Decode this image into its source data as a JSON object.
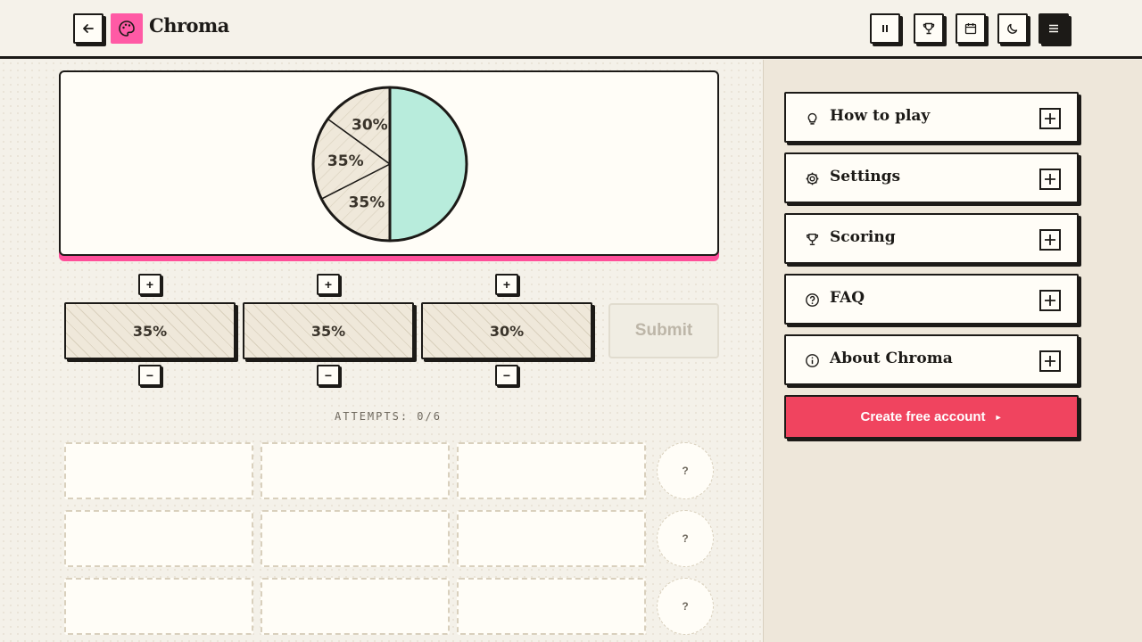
{
  "header": {
    "title": "Chroma",
    "brand_color": "#ff5aa5",
    "icons": [
      "back-arrow-icon",
      "palette-icon",
      "pause-icon",
      "trophy-icon",
      "calendar-icon",
      "moon-icon",
      "menu-icon"
    ]
  },
  "chart_data": {
    "type": "pie",
    "slices": [
      {
        "label": "30%",
        "value": 30,
        "style": "hatched"
      },
      {
        "label": "35%",
        "value": 35,
        "style": "hatched"
      },
      {
        "label": "35%",
        "value": 35,
        "style": "hatched"
      },
      {
        "label": "",
        "value": 50,
        "color": "#b8ecdc",
        "note": "target color half"
      }
    ],
    "accent_color": "#ff4f9a"
  },
  "guess": {
    "values": [
      "35%",
      "35%",
      "30%"
    ],
    "plus_label": "+",
    "minus_label": "−",
    "submit_label": "Submit"
  },
  "attempts_label": "ATTEMPTS: 0/6",
  "history": {
    "rows": 3,
    "placeholder": "?"
  },
  "sidebar": {
    "items": [
      {
        "label": "How to play",
        "icon": "lightbulb-icon"
      },
      {
        "label": "Settings",
        "icon": "gear-icon"
      },
      {
        "label": "Scoring",
        "icon": "trophy-icon"
      },
      {
        "label": "FAQ",
        "icon": "question-icon"
      },
      {
        "label": "About Chroma",
        "icon": "info-icon"
      }
    ],
    "cta_label": "Create free account",
    "cta_arrow": "►",
    "cta_color": "#f0445f"
  }
}
